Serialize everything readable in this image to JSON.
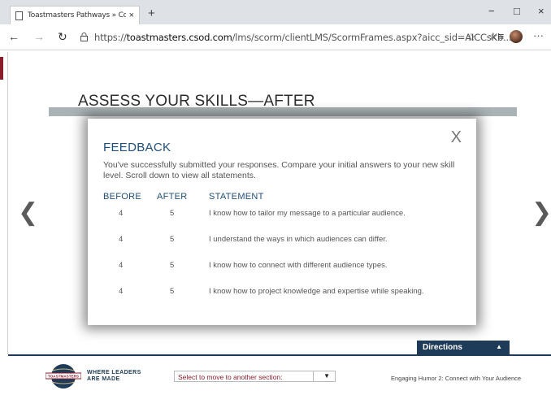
{
  "browser": {
    "tab_title": "Toastmasters Pathways » Conne",
    "tab_close": "×",
    "new_tab": "+",
    "minimize": "−",
    "maximize": "□",
    "close": "×",
    "back": "←",
    "forward": "→",
    "refresh": "↻",
    "url_prefix": "https://",
    "url_host": "toastmasters.csod.com",
    "url_path": "/lms/scorm/clientLMS/ScormFrames.aspx?aicc_sid=AICCsKb...",
    "star": "☆",
    "favorites": "☆≡",
    "more": "···"
  },
  "page": {
    "header_title": "ASSESS YOUR SKILLS—AFTER",
    "prev_arrow": "❮",
    "next_arrow": "❯"
  },
  "modal": {
    "close": "X",
    "title": "FEEDBACK",
    "message": "You've successfully submitted your responses. Compare your initial answers to your new skill level. Scroll down to view all statements.",
    "columns": {
      "before": "BEFORE",
      "after": "AFTER",
      "statement": "STATEMENT"
    },
    "rows": [
      {
        "before": "4",
        "after": "5",
        "statement": "I know how to tailor my message to a particular audience."
      },
      {
        "before": "4",
        "after": "5",
        "statement": "I understand the ways in which audiences can differ."
      },
      {
        "before": "4",
        "after": "5",
        "statement": "I know how to connect with different audience types."
      },
      {
        "before": "4",
        "after": "5",
        "statement": "I know how to project knowledge and expertise while speaking."
      }
    ]
  },
  "footer": {
    "directions": "Directions",
    "directions_caret": "▲",
    "logo_text": "TOASTMASTERS",
    "tagline_line1": "WHERE LEADERS",
    "tagline_line2": "ARE MADE",
    "section_select": "Select to move to another section:",
    "select_caret": "▼",
    "course_title": "Engaging Humor 2: Connect with Your Audience"
  },
  "colors": {
    "brand_blue": "#1f3b5a",
    "feedback_blue": "#1f4e79",
    "maroon": "#8b1c2c",
    "header_bar": "#a9b2b5"
  }
}
